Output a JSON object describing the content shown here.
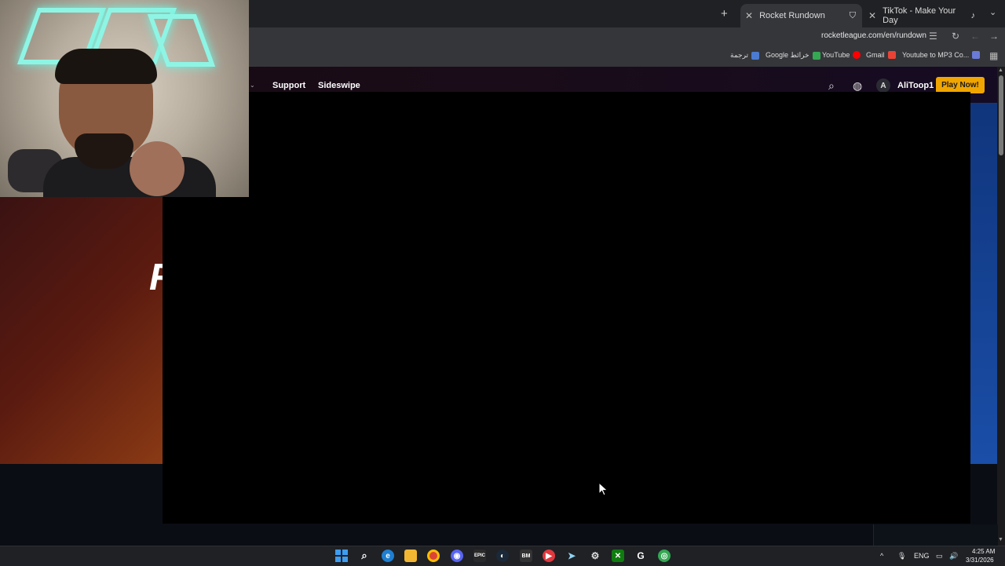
{
  "browser": {
    "tabs": [
      {
        "label": "Rocket Rundown",
        "active": true
      },
      {
        "label": "TikTok - Make Your Day",
        "active": false
      }
    ],
    "url": "rocketleague.com/en/rundown",
    "bookmarks": [
      {
        "label": "ترجمة",
        "color": "#4a7bd0"
      },
      {
        "label": "Google خرائط",
        "color": "#34a853"
      },
      {
        "label": "YouTube",
        "color": "#ff0000"
      },
      {
        "label": "Gmail",
        "color": "#ea4335"
      },
      {
        "label": "Youtube to MP3 Co...",
        "color": "#6a7ad8"
      }
    ]
  },
  "site": {
    "nav_items": [
      {
        "label": "Support"
      },
      {
        "label": "Sideswipe"
      }
    ],
    "account": {
      "avatar_letter": "A",
      "username": "AliToop1"
    },
    "cta": "Play Now!",
    "hero_glyph": "R"
  },
  "taskbar": {
    "apps": [
      {
        "icon": "search-icon"
      },
      {
        "icon": "edge-icon"
      },
      {
        "icon": "file-explorer-icon"
      },
      {
        "icon": "chrome-icon"
      },
      {
        "icon": "discord-icon"
      },
      {
        "icon": "epic-games-icon"
      },
      {
        "icon": "steam-icon"
      },
      {
        "icon": "battle-net-icon"
      },
      {
        "icon": "media-player-icon"
      },
      {
        "icon": "telegram-icon"
      },
      {
        "icon": "settings-icon"
      },
      {
        "icon": "xbox-icon"
      },
      {
        "icon": "g-hub-icon"
      },
      {
        "icon": "chrome-alt-icon"
      }
    ],
    "language": "ENG",
    "time": "4:25 AM",
    "date": "3/31/2026"
  },
  "colors": {
    "accent": "#f0a500",
    "video_bg": "#000000",
    "webcam_glow": "#8ef5e5"
  }
}
